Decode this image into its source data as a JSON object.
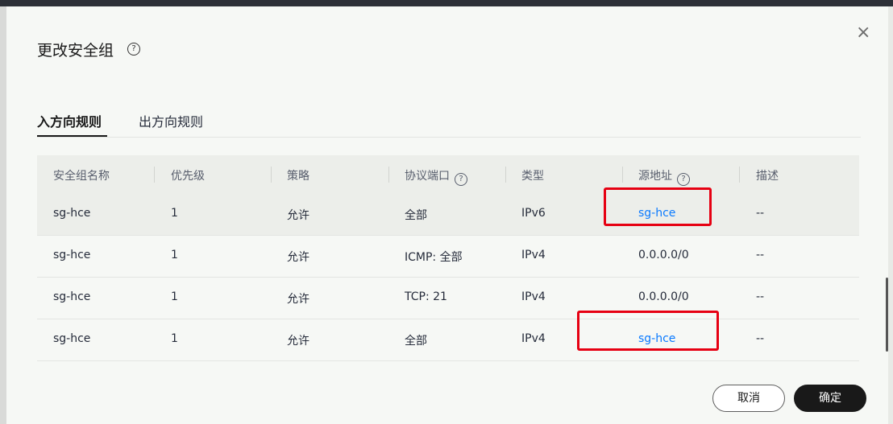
{
  "dialog": {
    "title": "更改安全组",
    "help_symbol": "?",
    "close_symbol": "×"
  },
  "tabs": [
    {
      "label": "入方向规则",
      "active": true
    },
    {
      "label": "出方向规则",
      "active": false
    }
  ],
  "table": {
    "headers": [
      "安全组名称",
      "优先级",
      "策略",
      "协议端口",
      "类型",
      "源地址",
      "描述"
    ],
    "help_symbol": "?",
    "rows": [
      [
        "sg-hce",
        "1",
        "允许",
        "全部",
        "IPv6",
        "sg-hce",
        "--"
      ],
      [
        "sg-hce",
        "1",
        "允许",
        "ICMP: 全部",
        "IPv4",
        "0.0.0.0/0",
        "--"
      ],
      [
        "sg-hce",
        "1",
        "允许",
        "TCP: 21",
        "IPv4",
        "0.0.0.0/0",
        "--"
      ],
      [
        "sg-hce",
        "1",
        "允许",
        "全部",
        "IPv4",
        "sg-hce",
        "--"
      ]
    ]
  },
  "footer": {
    "cancel_label": "取消",
    "confirm_label": "确定"
  },
  "colors": {
    "link": "#0a7aff",
    "highlight_box": "#e60012",
    "primary_button": "#191919"
  }
}
